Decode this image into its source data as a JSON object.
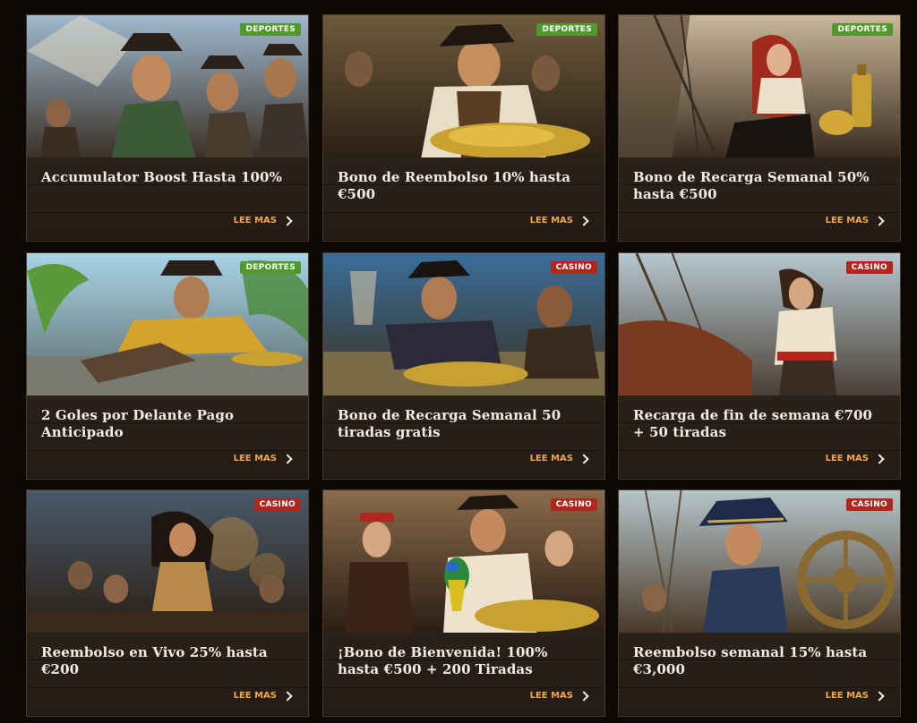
{
  "cards": [
    {
      "title": "Accumulator Boost Hasta 100%",
      "badge": "DEPORTES",
      "more": "LEE MAS"
    },
    {
      "title": "Bono de Reembolso 10% hasta €500",
      "badge": "DEPORTES",
      "more": "LEE MAS"
    },
    {
      "title": "Bono de Recarga Semanal 50% hasta €500",
      "badge": "DEPORTES",
      "more": "LEE MAS"
    },
    {
      "title": "2 Goles por Delante Pago Anticipado",
      "badge": "DEPORTES",
      "more": "LEE MAS"
    },
    {
      "title": "Bono de Recarga Semanal 50 tiradas gratis",
      "badge": "CASINO",
      "more": "LEE MAS"
    },
    {
      "title": "Recarga de fin de semana €700 + 50 tiradas",
      "badge": "CASINO",
      "more": "LEE MAS"
    },
    {
      "title": "Reembolso en Vivo 25% hasta €200",
      "badge": "CASINO",
      "more": "LEE MAS"
    },
    {
      "title": "¡Bono de Bienvenida! 100% hasta €500 + 200 Tiradas",
      "badge": "CASINO",
      "more": "LEE MAS"
    },
    {
      "title": "Reembolso semanal 15% hasta €3,000",
      "badge": "CASINO",
      "more": "LEE MAS"
    }
  ],
  "colors": {
    "deportes": "#4f9a2a",
    "casino": "#b3261e",
    "accent": "#f0a64a"
  }
}
